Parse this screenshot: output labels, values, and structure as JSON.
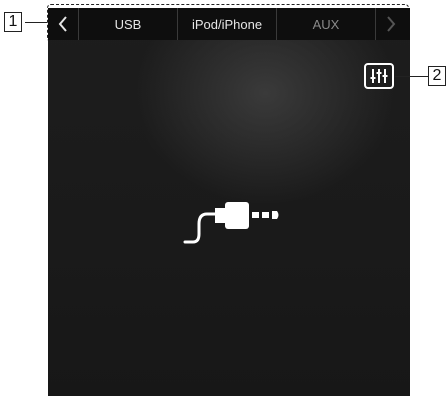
{
  "callouts": {
    "first": "1",
    "second": "2"
  },
  "tabs": [
    {
      "label": "USB",
      "active": false
    },
    {
      "label": "iPod/iPhone",
      "active": false
    },
    {
      "label": "AUX",
      "active": true
    }
  ],
  "icons": {
    "back": "chevron-left-icon",
    "forward": "chevron-right-icon",
    "equalizer": "equalizer-icon",
    "aux": "aux-plug-icon"
  },
  "colors": {
    "screen_background": "#1a1a1a",
    "tab_text": "#e6e6e6",
    "active_tab_text": "#8a8a8a"
  }
}
